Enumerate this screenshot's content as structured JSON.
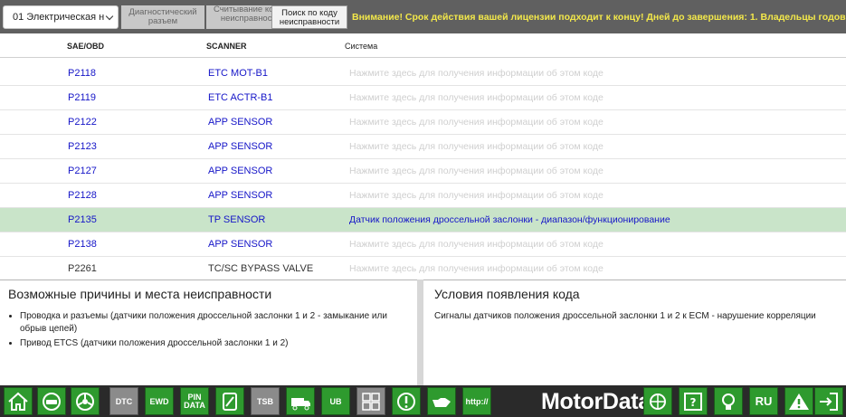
{
  "header": {
    "model_select": "01 Электрическая н",
    "tab_diag": "Диагностический разъем",
    "tab_read": "Считывание кодов неисправности",
    "tab_search": "Поиск по коду неисправности",
    "warning": "Внимание! Срок действия вашей лицензии подходит к концу! Дней до завершения: 1. Владельцы годовь"
  },
  "table": {
    "headers": {
      "sae": "SAE/OBD",
      "scanner": "SCANNER",
      "system": "Система"
    },
    "rows": [
      {
        "code": "P2118",
        "scanner": "ETC MOT-B1",
        "desc": "Нажмите здесь для получения информации об этом коде"
      },
      {
        "code": "P2119",
        "scanner": "ETC ACTR-B1",
        "desc": "Нажмите здесь для получения информации об этом коде"
      },
      {
        "code": "P2122",
        "scanner": "APP SENSOR",
        "desc": "Нажмите здесь для получения информации об этом коде"
      },
      {
        "code": "P2123",
        "scanner": "APP SENSOR",
        "desc": "Нажмите здесь для получения информации об этом коде"
      },
      {
        "code": "P2127",
        "scanner": "APP SENSOR",
        "desc": "Нажмите здесь для получения информации об этом коде"
      },
      {
        "code": "P2128",
        "scanner": "APP SENSOR",
        "desc": "Нажмите здесь для получения информации об этом коде"
      },
      {
        "code": "P2135",
        "scanner": "TP SENSOR",
        "desc": "Датчик положения дроссельной заслонки - диапазон/функционирование"
      },
      {
        "code": "P2138",
        "scanner": "APP SENSOR",
        "desc": "Нажмите здесь для получения информации об этом коде"
      },
      {
        "code": "P2261",
        "scanner": "TC/SC BYPASS VALVE",
        "desc": "Нажмите здесь для получения информации об этом коде"
      }
    ]
  },
  "causes": {
    "title": "Возможные причины и места неисправности",
    "items": [
      "Проводка и разъемы (датчики положения дроссельной заслонки 1 и 2 - замыкание или обрыв цепей)",
      "Привод ETCS (датчики положения дроссельной заслонки 1 и 2)"
    ]
  },
  "conditions": {
    "title": "Условия появления кода",
    "text": "Сигналы датчиков положения дроссельной заслонки 1 и 2 к ECM - нарушение корреляции"
  },
  "toolbar": {
    "brand": "MotorData",
    "lang": "RU",
    "dtc_label": "DTC",
    "ewd_label": "EWD",
    "pin_label": "PIN",
    "data_label": "DATA",
    "tsb_label": "TSB",
    "ub_label": "UB",
    "http_label": "http://"
  },
  "colors": {
    "topbar": "#606060",
    "warning": "#f3e84a",
    "link": "#1515c8",
    "selected_row": "#c9e4c9",
    "toolbar_green": "#2e9a2e",
    "toolbar_gray": "#8b8b8b"
  }
}
